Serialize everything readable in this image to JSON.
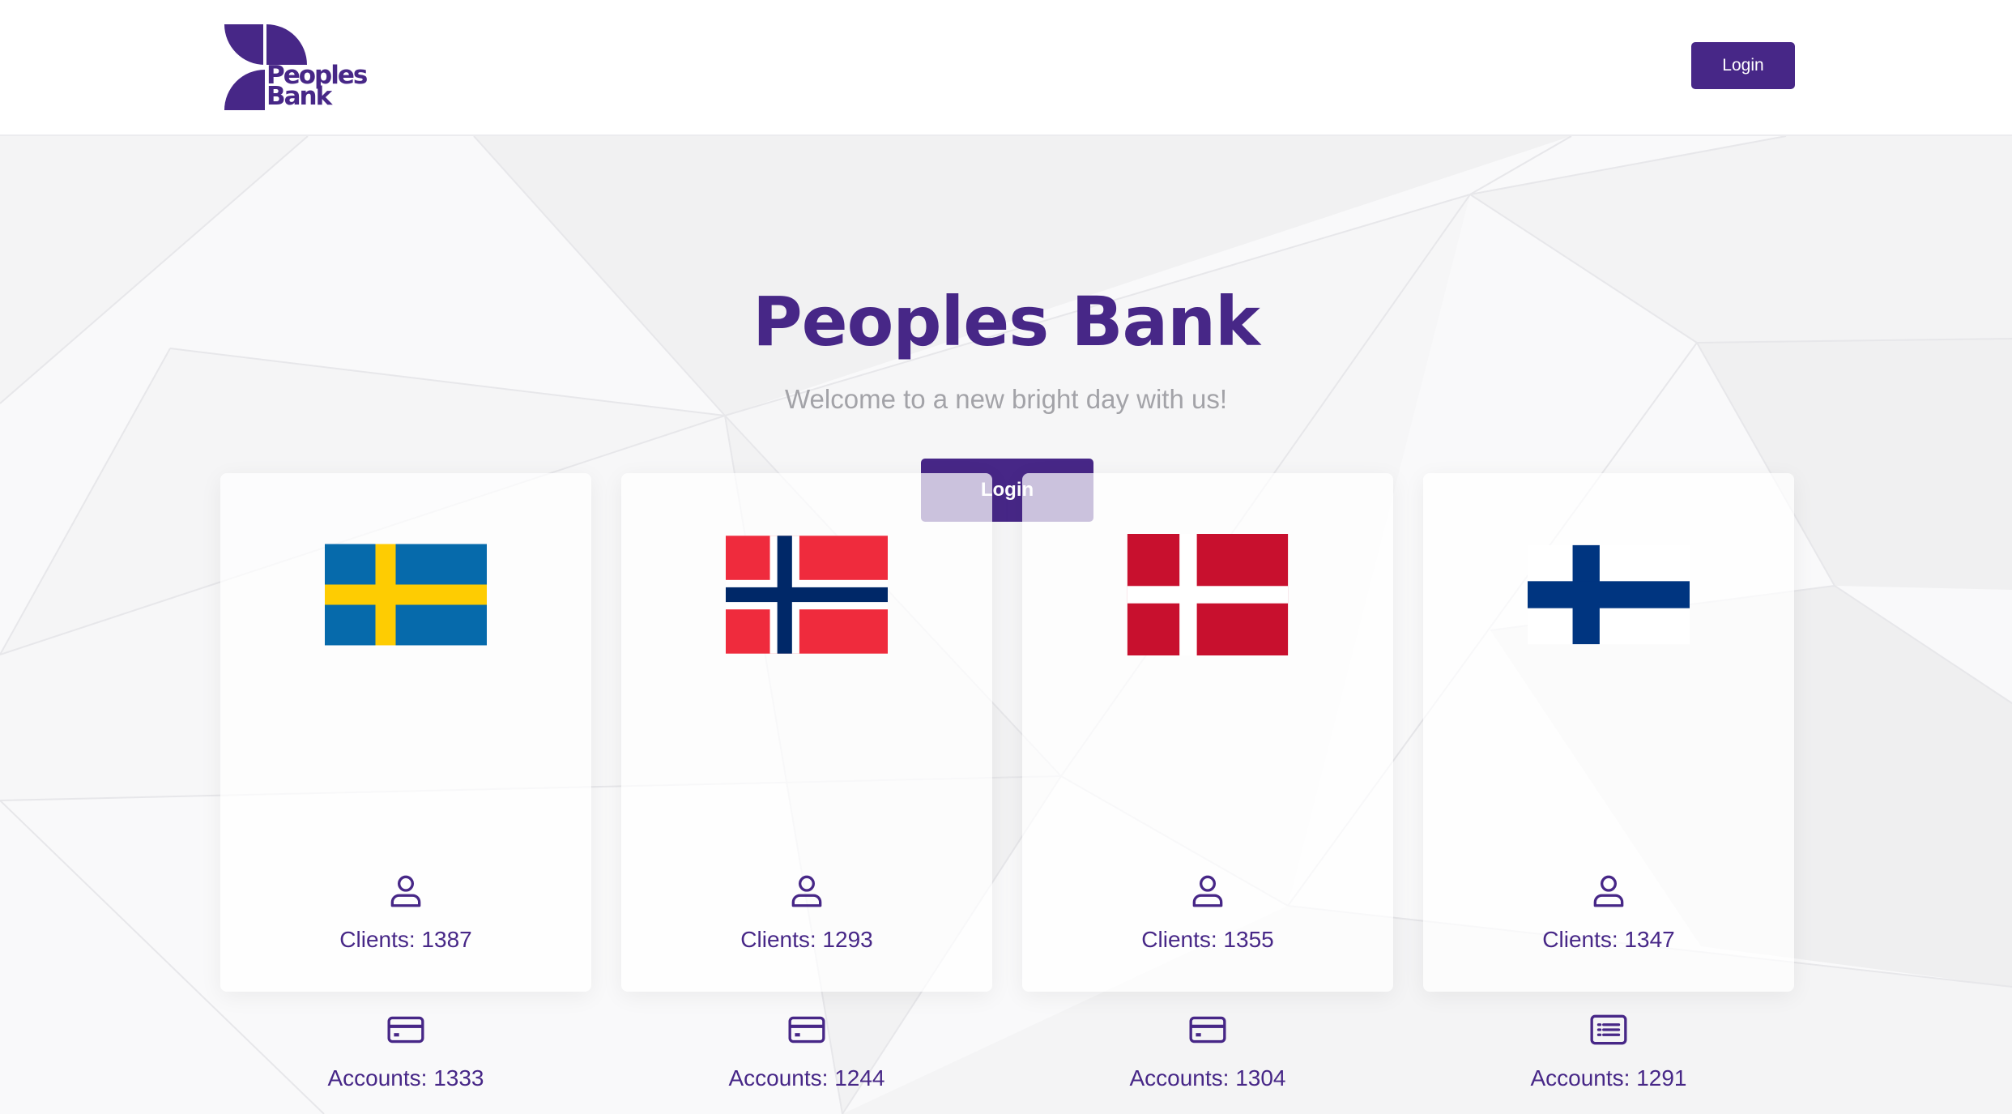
{
  "brand": {
    "logo_line1": "Peoples",
    "logo_line2": "Bank",
    "color": "#472787"
  },
  "nav": {
    "login_label": "Login"
  },
  "hero": {
    "title": "Peoples Bank",
    "subtitle": "Welcome to a new bright day with us!",
    "login_label": "Login"
  },
  "countries": [
    {
      "flag": "sweden-flag",
      "clients": "Clients: 1387",
      "accounts": "Accounts: 1333",
      "accounts_icon": "credit-card-icon"
    },
    {
      "flag": "norway-flag",
      "clients": "Clients: 1293",
      "accounts": "Accounts: 1244",
      "accounts_icon": "credit-card-icon"
    },
    {
      "flag": "denmark-flag",
      "clients": "Clients: 1355",
      "accounts": "Accounts: 1304",
      "accounts_icon": "credit-card-icon"
    },
    {
      "flag": "finland-flag",
      "clients": "Clients: 1347",
      "accounts": "Accounts: 1291",
      "accounts_icon": "list-icon"
    }
  ]
}
